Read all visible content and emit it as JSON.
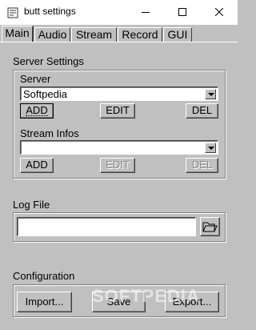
{
  "window": {
    "title": "butt settings"
  },
  "tabs": [
    {
      "label": "Main",
      "active": true
    },
    {
      "label": "Audio",
      "active": false
    },
    {
      "label": "Stream",
      "active": false
    },
    {
      "label": "Record",
      "active": false
    },
    {
      "label": "GUI",
      "active": false
    }
  ],
  "main": {
    "server_settings": {
      "heading": "Server Settings",
      "server": {
        "label": "Server",
        "selected": "Softpedia",
        "add": "ADD",
        "edit": "EDIT",
        "del": "DEL"
      },
      "stream_infos": {
        "label": "Stream Infos",
        "selected": "",
        "add": "ADD",
        "edit": "EDIT",
        "del": "DEL"
      }
    },
    "log_file": {
      "label": "Log File",
      "value": "",
      "browse_icon": "folder-open-icon"
    },
    "configuration": {
      "label": "Configuration",
      "import": "Import...",
      "save": "Save",
      "export": "Export..."
    }
  },
  "watermark": "SOFTPEDIA"
}
